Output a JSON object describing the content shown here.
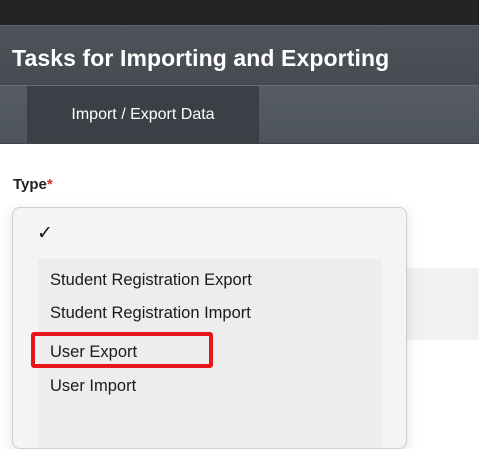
{
  "header": {
    "title": "Tasks for Importing and Exporting"
  },
  "tabs": [
    {
      "label": "Import / Export Data"
    }
  ],
  "form": {
    "type_label": "Type",
    "required_marker": "*",
    "type_dropdown": {
      "selected_indicator": "✓",
      "options": [
        "Student Registration Export",
        "Student Registration Import",
        "User Export",
        "User Import"
      ],
      "highlighted_option": "User Export"
    }
  },
  "colors": {
    "header_bg": "#4d535a",
    "tab_bg": "#3b4046",
    "required": "#d9342b",
    "highlight_border": "#e8151b"
  },
  "icons": {
    "selected_check": "checkmark-icon"
  }
}
